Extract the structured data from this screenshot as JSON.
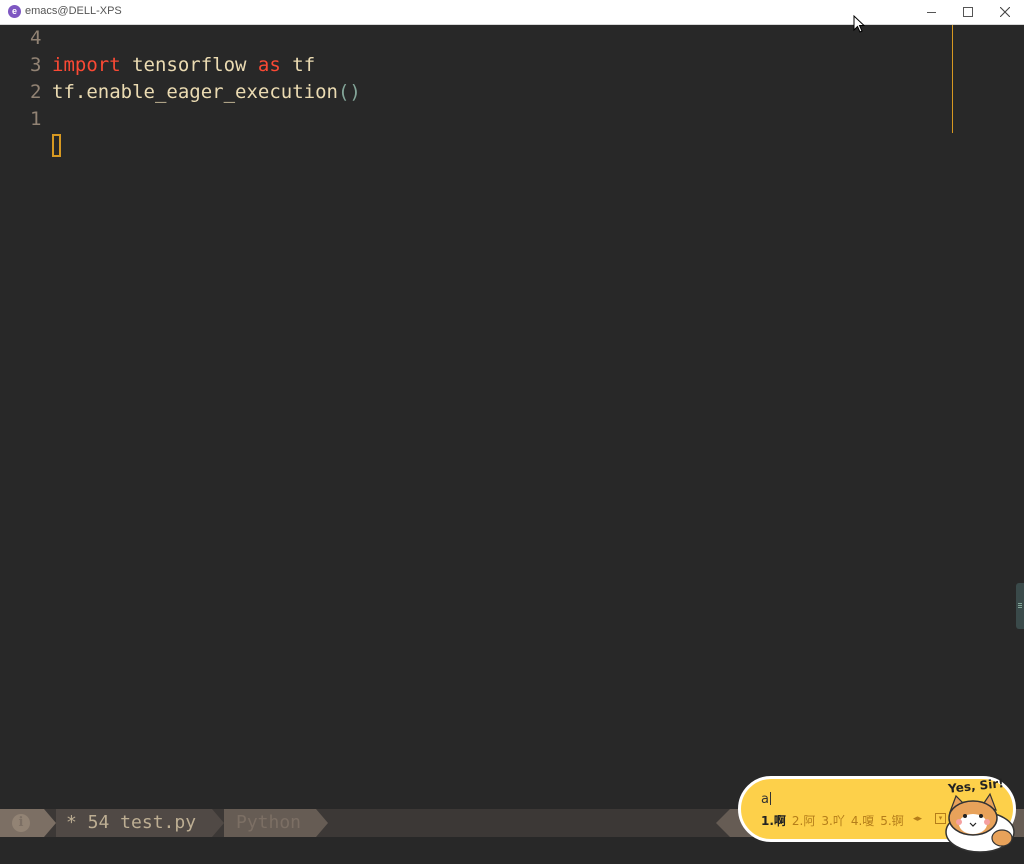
{
  "window": {
    "title": "emacs@DELL-XPS",
    "app_icon_glyph": "e",
    "controls": [
      "minimize-icon",
      "maximize-icon",
      "close-icon"
    ]
  },
  "editor": {
    "lines": [
      {
        "num": "4",
        "tokens": []
      },
      {
        "num": "3",
        "tokens": [
          {
            "text": "import",
            "kind": "keyword"
          },
          {
            "text": " tensorflow ",
            "kind": "plain"
          },
          {
            "text": "as",
            "kind": "keyword"
          },
          {
            "text": " tf",
            "kind": "plain"
          }
        ]
      },
      {
        "num": "2",
        "tokens": [
          {
            "text": "tf.enable_eager_execution",
            "kind": "plain"
          },
          {
            "text": "()",
            "kind": "paren"
          }
        ]
      },
      {
        "num": "1",
        "tokens": []
      }
    ],
    "colors": {
      "background": "#282828",
      "keyword": "#fb4934",
      "plain": "#ebdbb2",
      "line_number": "#928374",
      "cursor": "#d79921"
    }
  },
  "modeline": {
    "info_icon": "i",
    "buffer": "* 54 test.py",
    "major_mode": "Python"
  },
  "ime": {
    "input": "a",
    "candidates": [
      "1.啊",
      "2.阿",
      "3.吖",
      "4.嗄",
      "5.锕"
    ],
    "selected_index": 0,
    "slogan": "Yes, Sir!",
    "nav_glyph": "◂▸",
    "pin_glyph": "▾"
  }
}
